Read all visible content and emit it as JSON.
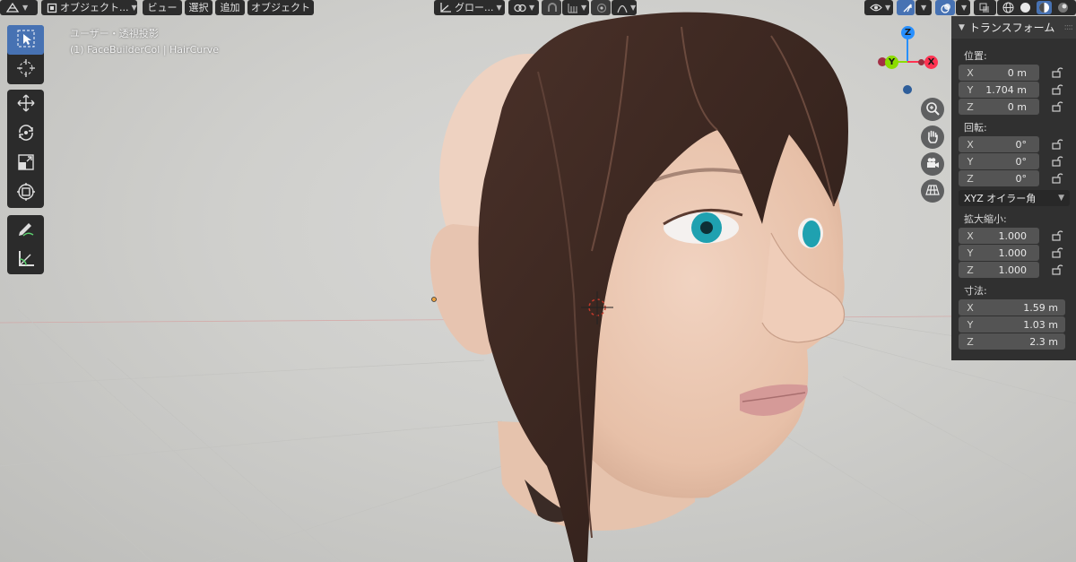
{
  "header": {
    "mode_label": "オブジェクト...",
    "menus": [
      "ビュー",
      "選択",
      "追加",
      "オブジェクト"
    ],
    "transform_orientation": "グロー..."
  },
  "viewport": {
    "view_name": "ユーザー・透視投影",
    "object_info": "(1) FaceBuilderCol | HairCurve"
  },
  "gizmo": {
    "z": "Z",
    "y": "Y",
    "x": "X"
  },
  "npanel": {
    "title": "トランスフォーム",
    "location": {
      "label": "位置:",
      "x": {
        "axis": "X",
        "value": "0 m"
      },
      "y": {
        "axis": "Y",
        "value": "1.704 m"
      },
      "z": {
        "axis": "Z",
        "value": "0 m"
      }
    },
    "rotation": {
      "label": "回転:",
      "x": {
        "axis": "X",
        "value": "0°"
      },
      "y": {
        "axis": "Y",
        "value": "0°"
      },
      "z": {
        "axis": "Z",
        "value": "0°"
      }
    },
    "rotation_mode": "XYZ オイラー角",
    "scale": {
      "label": "拡大縮小:",
      "x": {
        "axis": "X",
        "value": "1.000"
      },
      "y": {
        "axis": "Y",
        "value": "1.000"
      },
      "z": {
        "axis": "Z",
        "value": "1.000"
      }
    },
    "dimensions": {
      "label": "寸法:",
      "x": {
        "axis": "X",
        "value": "1.59 m"
      },
      "y": {
        "axis": "Y",
        "value": "1.03 m"
      },
      "z": {
        "axis": "Z",
        "value": "2.3 m"
      }
    }
  },
  "colors": {
    "active_blue": "#4772b3",
    "axis_x": "#ff3352",
    "axis_y": "#8bdc00",
    "axis_z": "#2890ff"
  },
  "icons": [
    "select-box-icon",
    "cursor-icon",
    "move-icon",
    "rotate-icon",
    "scale-icon",
    "transform-icon",
    "annotate-icon",
    "measure-icon",
    "zoom-icon",
    "hand-icon",
    "camera-icon",
    "grid-icon"
  ]
}
